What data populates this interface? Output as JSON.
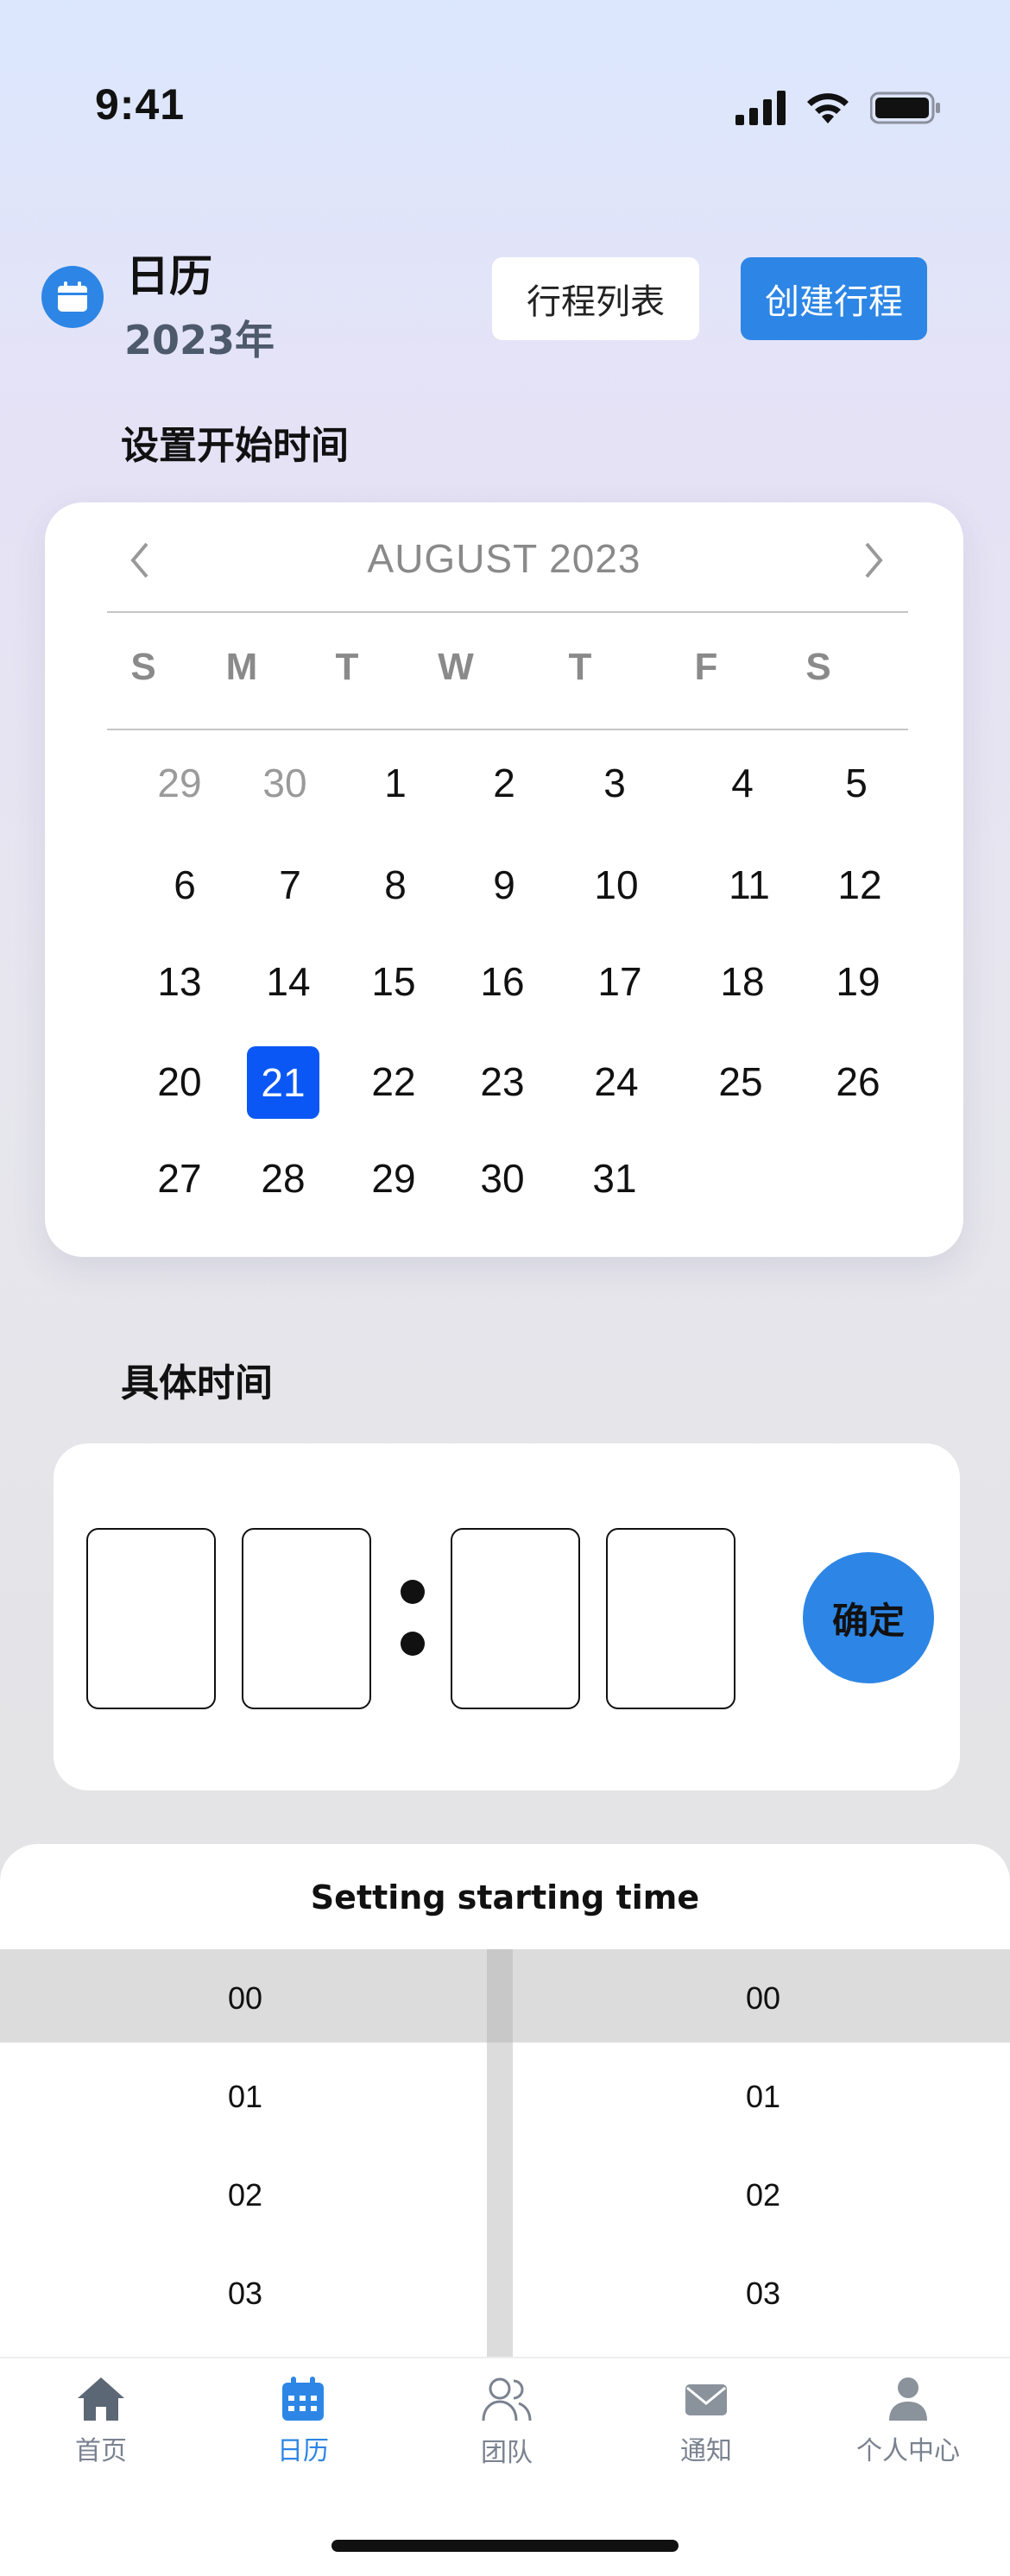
{
  "status_bar": {
    "time": "9:41"
  },
  "header": {
    "icon": "calendar-icon",
    "title": "日历",
    "year": "2023年",
    "list_button": "行程列表",
    "create_button": "创建行程",
    "accent": "#2d86e5"
  },
  "start_section": {
    "title": "设置开始时间"
  },
  "calendar": {
    "month_label": "AUGUST 2023",
    "prev_icon": "chevron-left-icon",
    "next_icon": "chevron-right-icon",
    "weekdays": [
      "S",
      "M",
      "T",
      "W",
      "T",
      "F",
      "S"
    ],
    "weeks": [
      [
        "29",
        "30",
        "1",
        "2",
        "3",
        "4",
        "5"
      ],
      [
        "6",
        "7",
        "8",
        "9",
        "10",
        "11",
        "12"
      ],
      [
        "13",
        "14",
        "15",
        "16",
        "17",
        "18",
        "19"
      ],
      [
        "20",
        "21",
        "22",
        "23",
        "24",
        "25",
        "26"
      ],
      [
        "27",
        "28",
        "29",
        "30",
        "31"
      ]
    ],
    "selected_day": "21",
    "selected_color": "#0a57f5"
  },
  "time_section": {
    "title": "具体时间",
    "confirm": "确定"
  },
  "picker": {
    "title": "Setting starting time",
    "hours": [
      "00",
      "01",
      "02",
      "03"
    ],
    "minutes": [
      "00",
      "01",
      "02",
      "03"
    ]
  },
  "tabbar": {
    "items": [
      {
        "label": "首页",
        "icon": "home-icon"
      },
      {
        "label": "日历",
        "icon": "calendar-icon"
      },
      {
        "label": "团队",
        "icon": "team-icon"
      },
      {
        "label": "通知",
        "icon": "mail-icon"
      },
      {
        "label": "个人中心",
        "icon": "person-icon"
      }
    ],
    "active_color": "#2d86e5",
    "inactive_color": "#7a8290"
  }
}
